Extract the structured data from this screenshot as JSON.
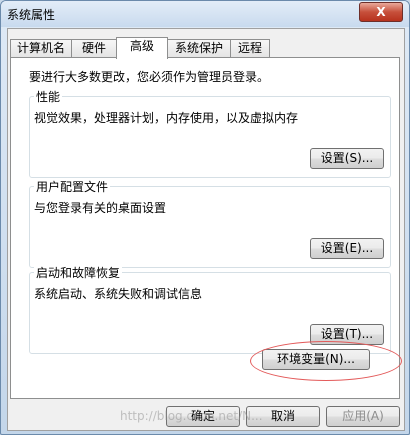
{
  "window": {
    "title": "系统属性",
    "close_label": "X"
  },
  "tabs": [
    {
      "label": "计算机名",
      "active": false
    },
    {
      "label": "硬件",
      "active": false
    },
    {
      "label": "高级",
      "active": true
    },
    {
      "label": "系统保护",
      "active": false
    },
    {
      "label": "远程",
      "active": false
    }
  ],
  "notice": "要进行大多数更改，您必须作为管理员登录。",
  "groups": {
    "performance": {
      "title": "性能",
      "desc": "视觉效果，处理器计划，内存使用，以及虚拟内存",
      "button": "设置(S)..."
    },
    "profile": {
      "title": "用户配置文件",
      "desc": "与您登录有关的桌面设置",
      "button": "设置(E)..."
    },
    "startup": {
      "title": "启动和故障恢复",
      "desc": "系统启动、系统失败和调试信息",
      "button": "设置(T)..."
    }
  },
  "env_button": "环境变量(N)...",
  "bottom": {
    "ok": "确定",
    "cancel": "取消",
    "apply": "应用(A)"
  },
  "watermark": "http://blog.csdn.net/N...",
  "colors": {
    "highlight_oval": "#e35a5a",
    "close_button": "#c7503b"
  }
}
